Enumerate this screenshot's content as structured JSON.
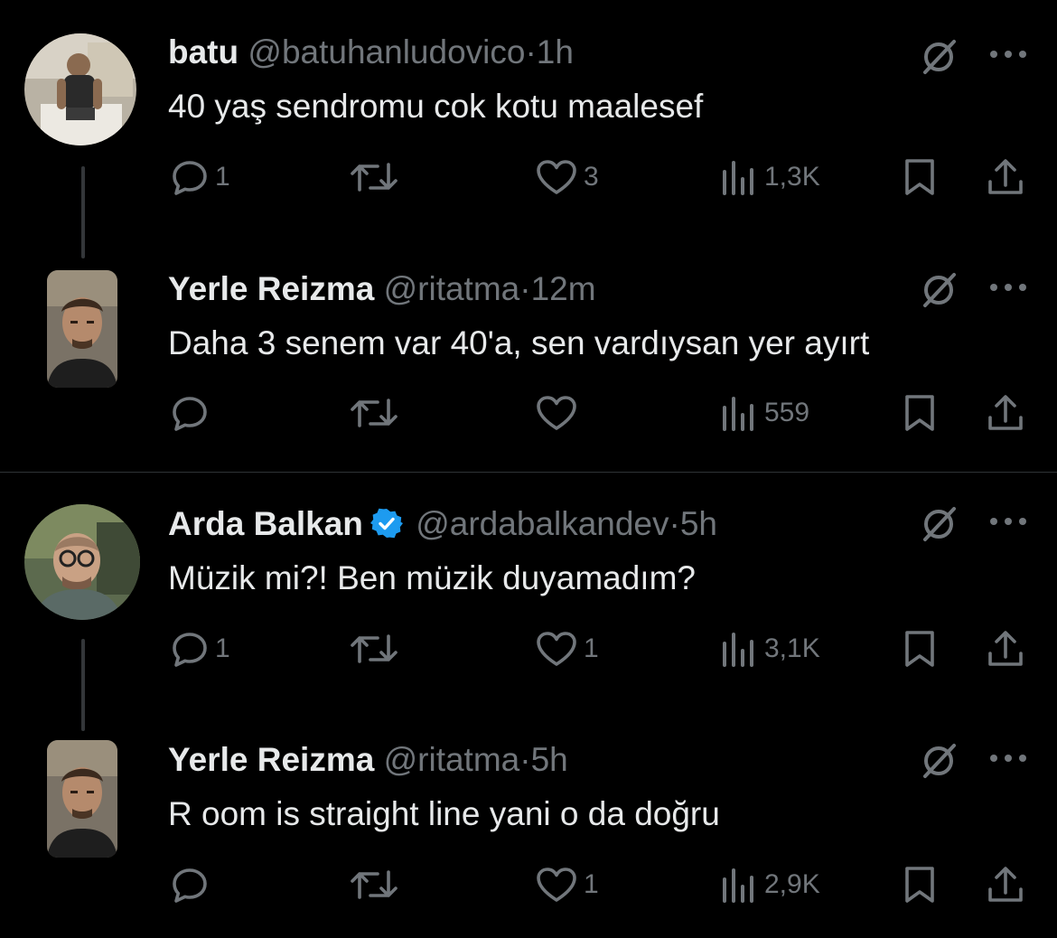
{
  "threads": [
    {
      "tweets": [
        {
          "name": "batu",
          "handle": "@batuhanludovico",
          "dot": "·",
          "time": "1h",
          "verified": false,
          "text": "40 yaş sendromu cok kotu maalesef",
          "replies": "1",
          "reposts": "",
          "likes": "3",
          "views": "1,3K"
        },
        {
          "name": "Yerle Reizma",
          "handle": "@ritatma",
          "dot": "·",
          "time": "12m",
          "verified": false,
          "text": "Daha 3 senem var 40'a, sen vardıysan yer ayırt",
          "replies": "",
          "reposts": "",
          "likes": "",
          "views": "559"
        }
      ]
    },
    {
      "tweets": [
        {
          "name": "Arda Balkan",
          "handle": "@ardabalkandev",
          "dot": "·",
          "time": "5h",
          "verified": true,
          "text": "Müzik mi?! Ben müzik duyamadım?",
          "replies": "1",
          "reposts": "",
          "likes": "1",
          "views": "3,1K"
        },
        {
          "name": "Yerle Reizma",
          "handle": "@ritatma",
          "dot": "·",
          "time": "5h",
          "verified": false,
          "text": "R oom is straight line yani o da doğru",
          "replies": "",
          "reposts": "",
          "likes": "1",
          "views": "2,9K"
        }
      ]
    }
  ],
  "colors": {
    "background": "#000000",
    "text": "#e7e9ea",
    "secondary": "#71767b",
    "verified": "#1d9bf0",
    "divider": "#2f3336"
  },
  "icons": [
    "reply-icon",
    "repost-icon",
    "like-icon",
    "views-icon",
    "bookmark-icon",
    "share-icon",
    "grok-icon",
    "more-icon",
    "verified-badge-icon"
  ]
}
